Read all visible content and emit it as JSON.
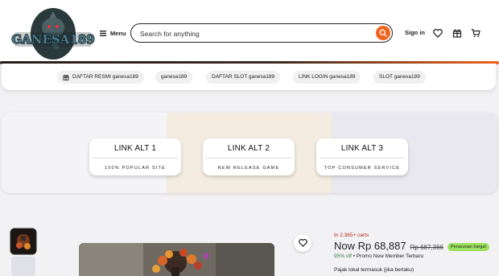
{
  "header": {
    "logo_text": "GANESA189",
    "menu_label": "Menu",
    "search_placeholder": "Search for anything",
    "signin_label": "Sign in"
  },
  "nav": {
    "chips": [
      {
        "label": "DAFTAR RESMI ganesa189",
        "icon": "gift-icon"
      },
      {
        "label": "ganesa189"
      },
      {
        "label": "DAFTAR SLOT ganesa189"
      },
      {
        "label": "LINK LOGIN ganesa189"
      },
      {
        "label": "SLOT ganesa189"
      }
    ]
  },
  "banner": {
    "cards": [
      {
        "title": "LINK ALT 1",
        "subtitle": "100% POPULAR SITE"
      },
      {
        "title": "LINK ALT 2",
        "subtitle": "NEW RELEASE GAME"
      },
      {
        "title": "LINK ALT 3",
        "subtitle": "TOP CONSUMER SERVICE"
      }
    ]
  },
  "product": {
    "carts_text": "In 2.365+ carts",
    "now_price": "Now Rp 68,887",
    "old_price": "Rp 687,366",
    "badge": "Penurunan harga!",
    "discount": "95% off",
    "dot": "•",
    "promo": "Promo New Member Terbaru",
    "tax_note": "Pajak lokal termasuk (jika berlaku)"
  },
  "colors": {
    "accent": "#f1641e",
    "badge_green": "#9be15d",
    "sale_red": "#b3261e"
  }
}
